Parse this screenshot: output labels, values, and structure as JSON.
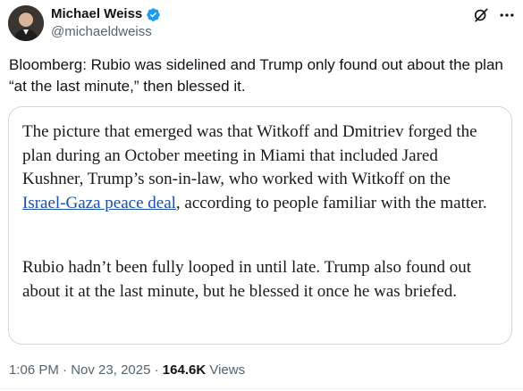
{
  "author": {
    "name": "Michael Weiss",
    "handle": "@michaeldweiss",
    "verified_color": "#1d9bf0"
  },
  "tweet": {
    "text": "Bloomberg: Rubio was sidelined and Trump only found out about the plan “at the last minute,” then blessed it."
  },
  "quote": {
    "para1_before_link": "The picture that emerged was that Witkoff and Dmitriev forged the plan during an October meeting in Miami that included Jared Kushner, Trump’s son-in-law, who worked with Witkoff on the ",
    "link_text": "Israel-Gaza peace deal",
    "para1_after_link": ", according to people familiar with the matter.",
    "para2": "Rubio hadn’t been fully looped in until late. Trump also found out about it at the last minute, but he blessed it once he was briefed."
  },
  "meta": {
    "time": "1:06 PM",
    "separator": "·",
    "date": "Nov 23, 2025",
    "views_count": "164.6K",
    "views_label": "Views"
  },
  "icons": {
    "verified": "verified-badge-icon",
    "grok": "grok-icon",
    "more": "more-options-icon"
  },
  "colors": {
    "text": "#0f1419",
    "secondary": "#536471",
    "link": "#1a4fa8",
    "border": "#cfd9de"
  }
}
